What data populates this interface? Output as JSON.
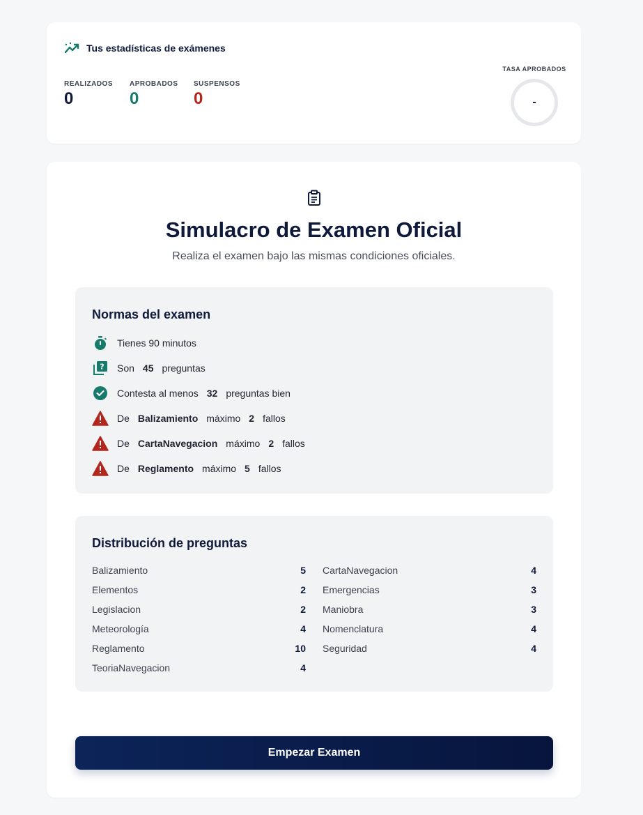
{
  "stats": {
    "title": "Tus estadísticas de exámenes",
    "items": [
      {
        "label": "REALIZADOS",
        "value": "0",
        "color": "#0f1a3a"
      },
      {
        "label": "APROBADOS",
        "value": "0",
        "color": "#177a6a"
      },
      {
        "label": "SUSPENSOS",
        "value": "0",
        "color": "#b3261e"
      }
    ],
    "rate": {
      "label": "TASA APROBADOS",
      "value": "-"
    }
  },
  "exam": {
    "title": "Simulacro de Examen Oficial",
    "subtitle": "Realiza el examen bajo las mismas condiciones oficiales.",
    "rules": {
      "title": "Normas del examen",
      "time": {
        "text": "Tienes 90 minutos"
      },
      "questions": {
        "pre": "Son",
        "num": "45",
        "post": "preguntas"
      },
      "correct": {
        "pre": "Contesta al menos",
        "num": "32",
        "post": "preguntas bien"
      },
      "topic_limits": [
        {
          "pre": "De",
          "topic": "Balizamiento",
          "mid": "máximo",
          "num": "2",
          "post": "fallos"
        },
        {
          "pre": "De",
          "topic": "CartaNavegacion",
          "mid": "máximo",
          "num": "2",
          "post": "fallos"
        },
        {
          "pre": "De",
          "topic": "Reglamento",
          "mid": "máximo",
          "num": "5",
          "post": "fallos"
        }
      ]
    },
    "distribution": {
      "title": "Distribución de preguntas",
      "left": [
        {
          "name": "Balizamiento",
          "count": "5"
        },
        {
          "name": "Elementos",
          "count": "2"
        },
        {
          "name": "Legislacion",
          "count": "2"
        },
        {
          "name": "Meteorología",
          "count": "4"
        },
        {
          "name": "Reglamento",
          "count": "10"
        },
        {
          "name": "TeoriaNavegacion",
          "count": "4"
        }
      ],
      "right": [
        {
          "name": "CartaNavegacion",
          "count": "4"
        },
        {
          "name": "Emergencias",
          "count": "3"
        },
        {
          "name": "Maniobra",
          "count": "3"
        },
        {
          "name": "Nomenclatura",
          "count": "4"
        },
        {
          "name": "Seguridad",
          "count": "4"
        }
      ]
    },
    "start_label": "Empezar Examen"
  },
  "colors": {
    "teal": "#177a6a",
    "red": "#b3261e",
    "navy": "#0f1a3a"
  }
}
